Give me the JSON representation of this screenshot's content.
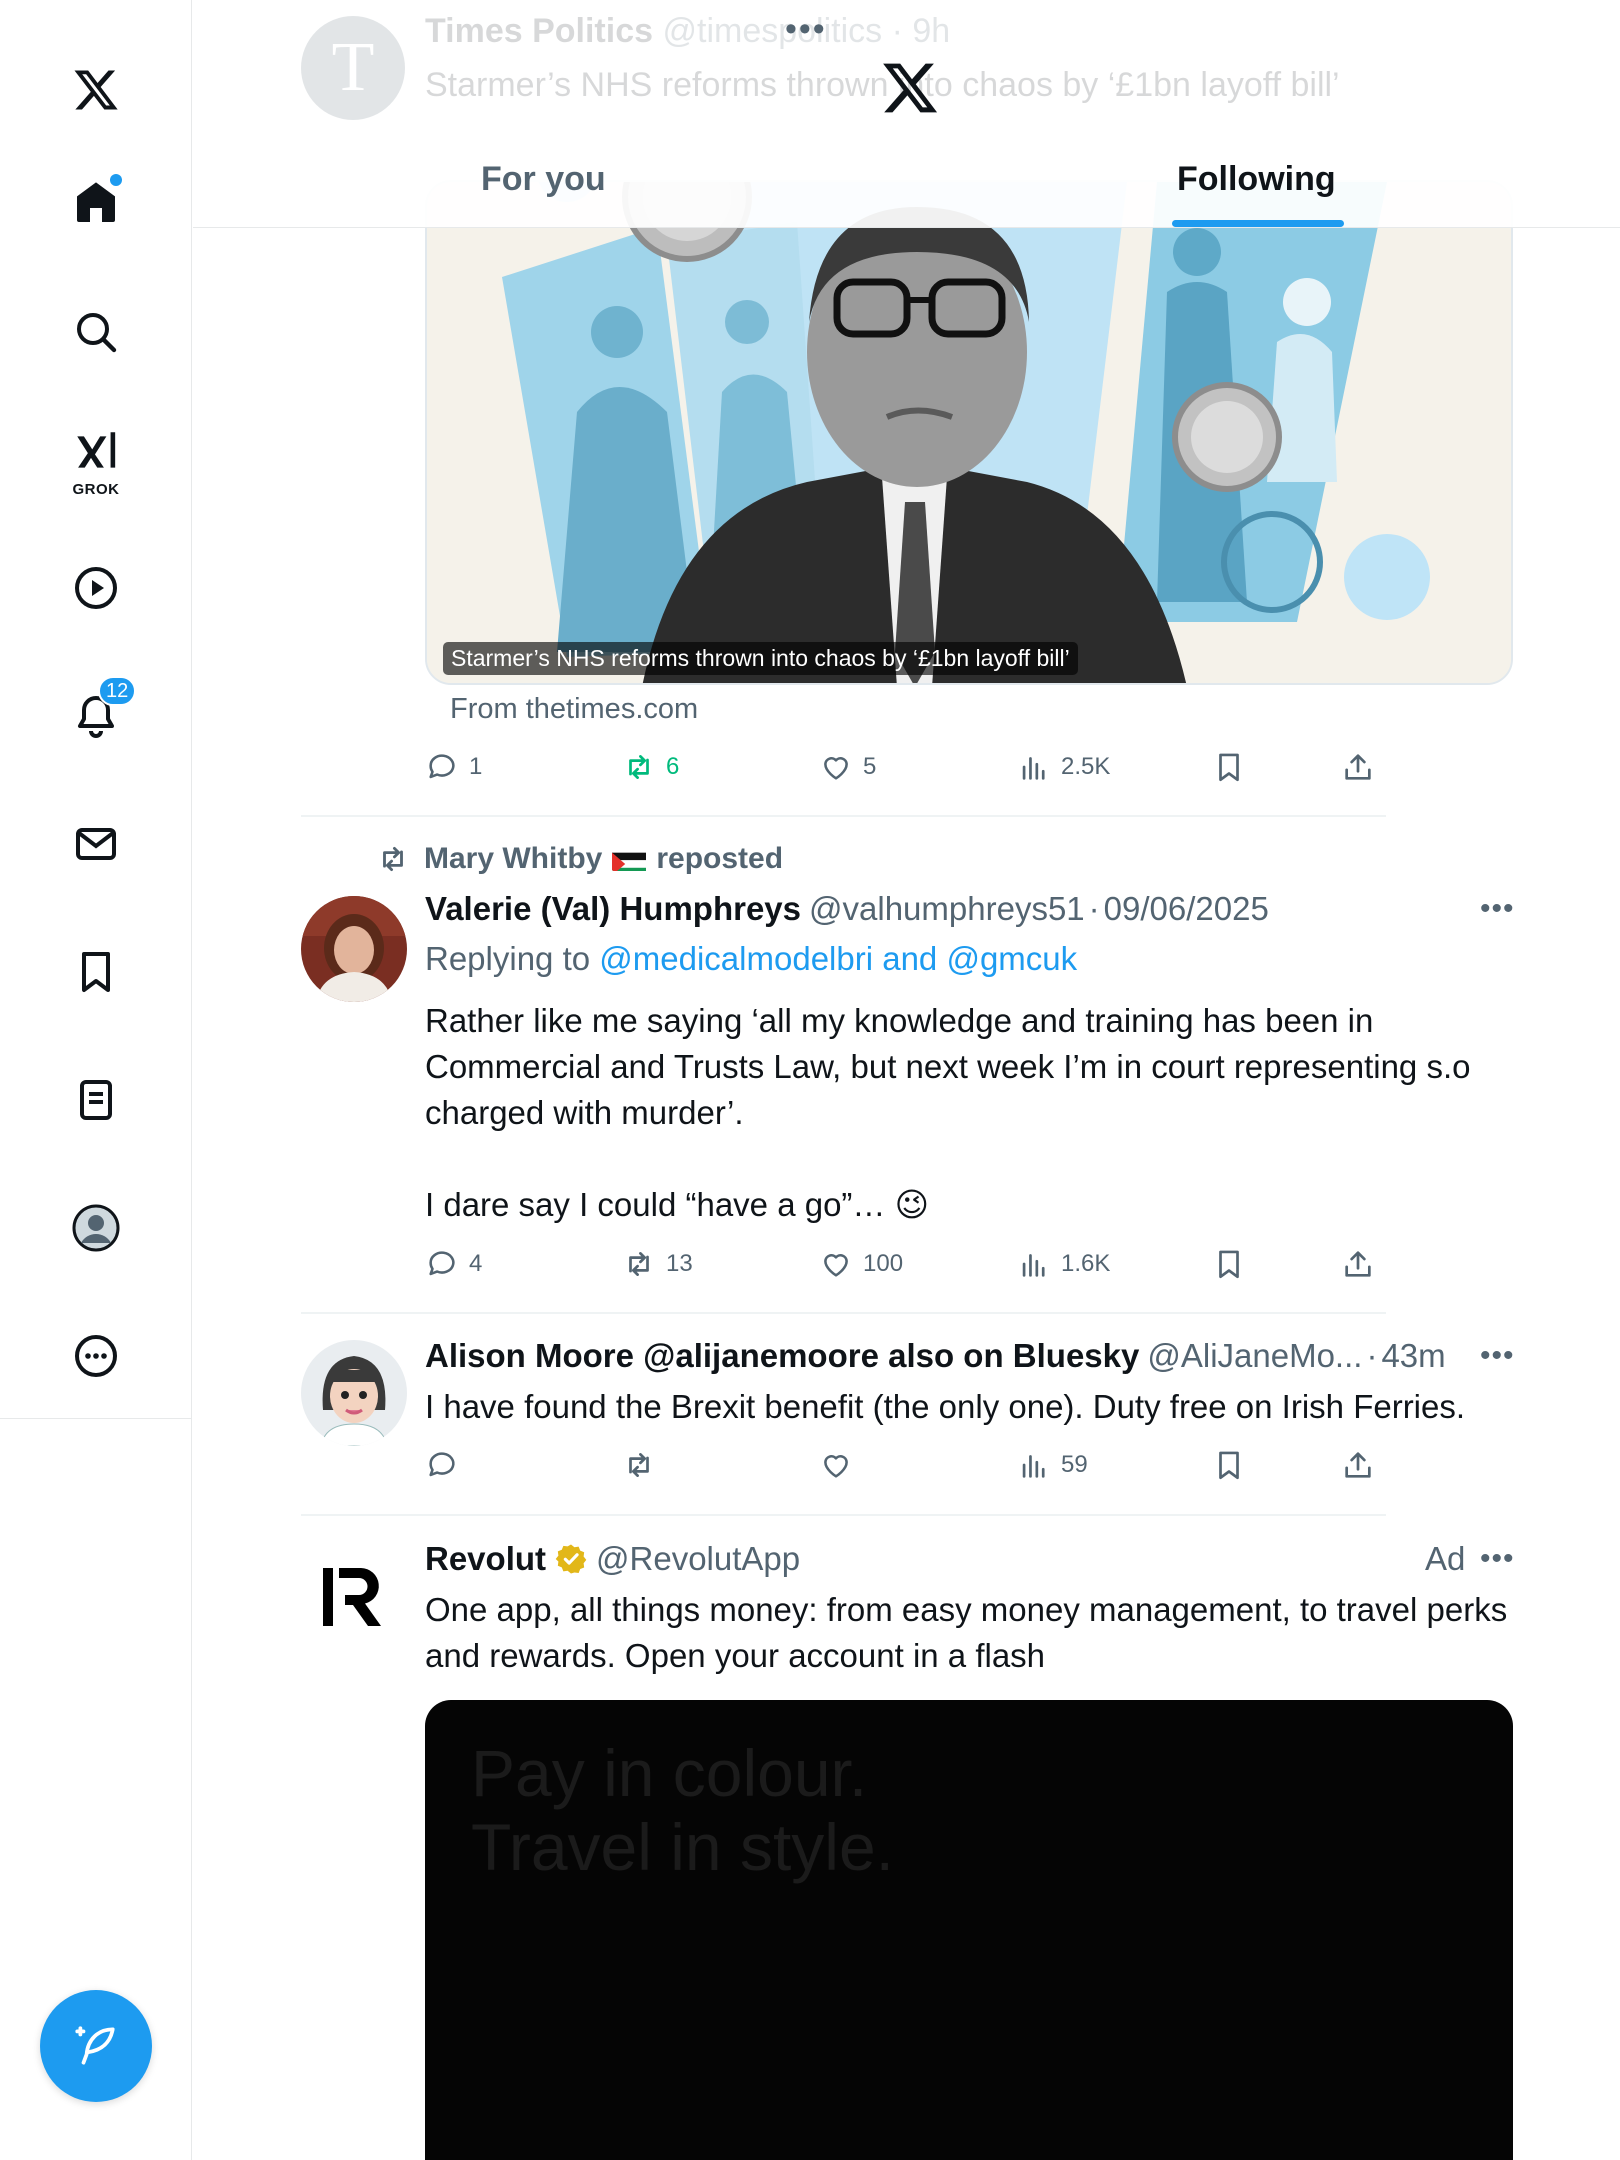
{
  "header": {
    "ghost_account": "Times Politics",
    "ghost_handle": "@timespolitics",
    "ghost_time": "9h",
    "ghost_text": "Starmer’s NHS reforms thrown into chaos by ‘£1bn layoff bill’",
    "tabs": [
      {
        "label": "For you",
        "active": false
      },
      {
        "label": "Following",
        "active": true
      }
    ]
  },
  "sidebar": {
    "notifications_badge": "12",
    "grok_label": "GROK"
  },
  "posts": [
    {
      "media_caption": "Starmer’s NHS reforms thrown into chaos by ‘£1bn layoff bill’",
      "source": "From thetimes.com",
      "stats": {
        "replies": "1",
        "reposts": "6",
        "likes": "5",
        "views": "2.5K"
      },
      "reposted": true
    },
    {
      "repost_by": "Mary Whitby",
      "repost_suffix": "reposted",
      "name": "Valerie (Val) Humphreys",
      "handle": "@valhumphreys51",
      "time": "09/06/2025",
      "reply_prefix": "Replying to",
      "reply_targets": "@medicalmodelbri and @gmcuk",
      "text_1": "Rather like me saying ‘all my knowledge and training has been in Commercial and Trusts Law, but next week I’m in court representing s.o charged with murder’.",
      "text_2": "I dare say I could “have a go”… 😉",
      "stats": {
        "replies": "4",
        "reposts": "13",
        "likes": "100",
        "views": "1.6K"
      }
    },
    {
      "name": "Alison Moore @alijanemoore also on Bluesky",
      "handle": "@AliJaneMo...",
      "time": "43m",
      "text": "I have found the Brexit benefit (the only one). Duty free on Irish Ferries.",
      "stats": {
        "replies": "",
        "reposts": "",
        "likes": "",
        "views": "59"
      }
    },
    {
      "name": "Revolut",
      "handle": "@RevolutApp",
      "ad_label": "Ad",
      "text": "One app, all things money: from easy money management, to travel perks and rewards. Open your account in a flash",
      "media_headline_1": "Pay in colour.",
      "media_headline_2": "Travel in style."
    }
  ],
  "colors": {
    "accent": "#1d9bf0",
    "text_primary": "#0f1419",
    "text_secondary": "#536471",
    "repost_green": "#00ba7c",
    "verified_gold": "#e2b719"
  }
}
